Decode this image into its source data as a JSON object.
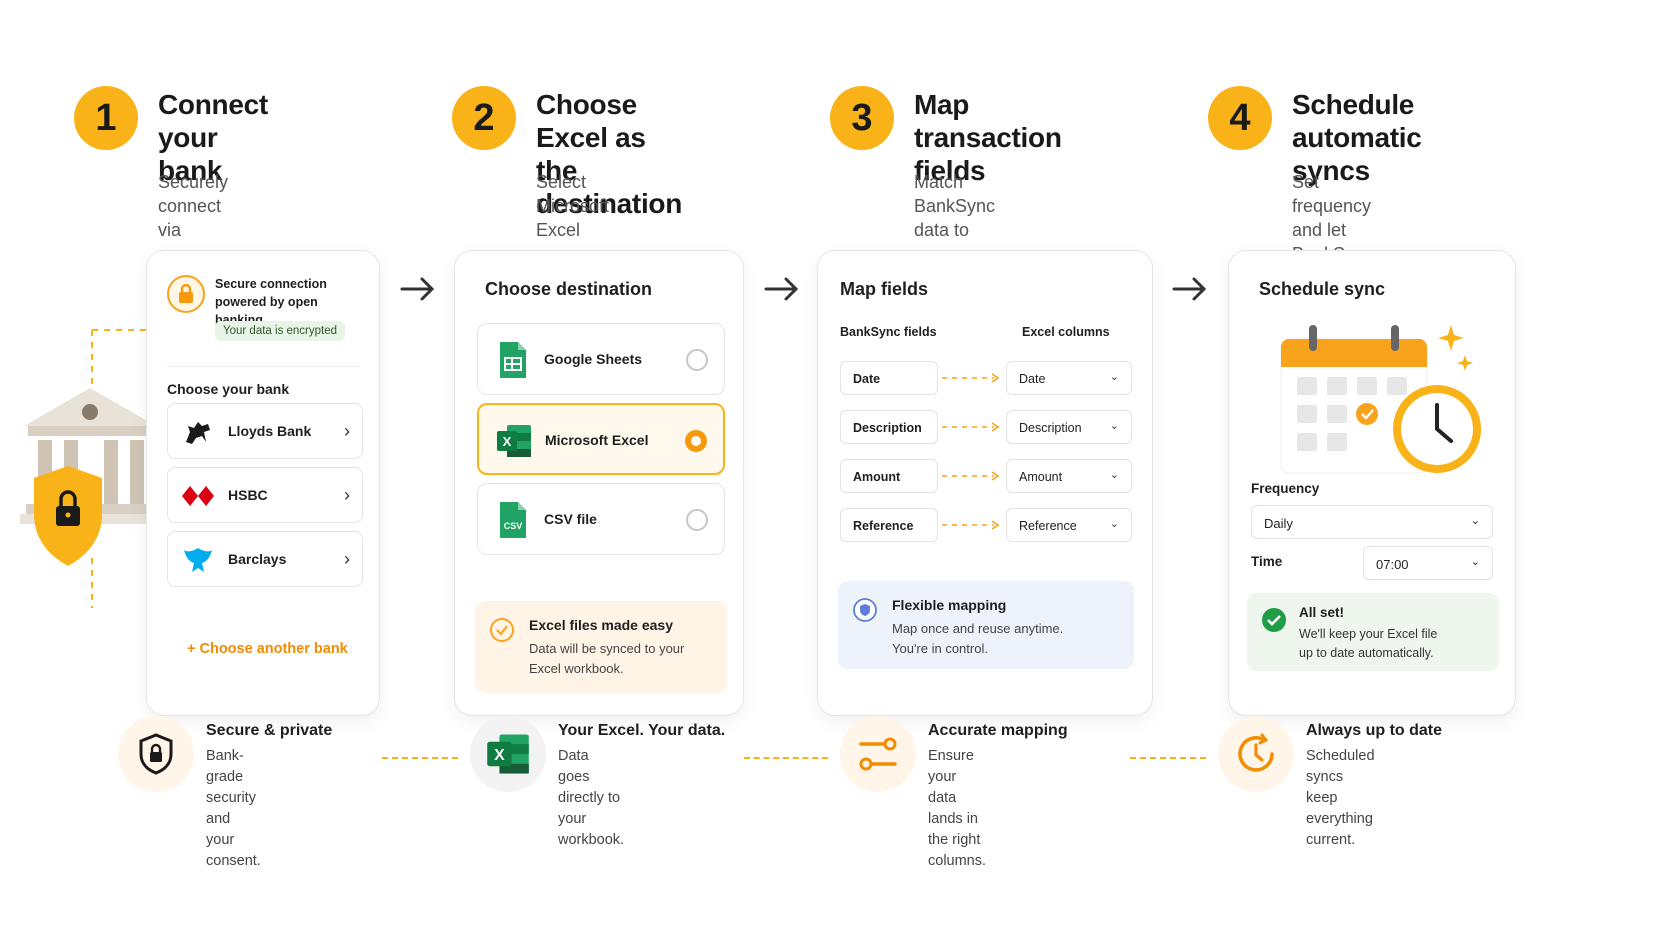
{
  "steps": [
    {
      "number": "1",
      "title": "Connect\nyour bank",
      "desc": "Securely connect via\nopen banking."
    },
    {
      "number": "2",
      "title": "Choose Excel as\nthe destination",
      "desc": "Select Microsoft Excel\nas your output."
    },
    {
      "number": "3",
      "title": "Map transaction\nfields",
      "desc": "Match BankSync data to\nyour Excel columns."
    },
    {
      "number": "4",
      "title": "Schedule automatic\nsyncs",
      "desc": "Set frequency and let\nBankSync do the rest."
    }
  ],
  "connect": {
    "secure_text": "Secure connection\npowered by open banking",
    "encrypted_badge": "Your data is encrypted",
    "choose_label": "Choose your bank",
    "banks": [
      {
        "name": "Lloyds Bank",
        "logo": "horse-icon"
      },
      {
        "name": "HSBC",
        "logo": "hsbc-hexagon-icon"
      },
      {
        "name": "Barclays",
        "logo": "eagle-icon"
      }
    ],
    "another_bank": "+   Choose another bank"
  },
  "destination": {
    "title": "Choose destination",
    "options": [
      {
        "name": "Google Sheets",
        "selected": false
      },
      {
        "name": "Microsoft Excel",
        "selected": true
      },
      {
        "name": "CSV file",
        "selected": false
      }
    ],
    "info_title": "Excel files made easy",
    "info_body": "Data will be synced to your\nExcel workbook."
  },
  "mapping": {
    "title": "Map fields",
    "col_source": "BankSync fields",
    "col_target": "Excel columns",
    "rows": [
      {
        "source": "Date",
        "target": "Date"
      },
      {
        "source": "Description",
        "target": "Description"
      },
      {
        "source": "Amount",
        "target": "Amount"
      },
      {
        "source": "Reference",
        "target": "Reference"
      }
    ],
    "info_title": "Flexible mapping",
    "info_body": "Map once and reuse anytime.\nYou're in control."
  },
  "schedule": {
    "title": "Schedule sync",
    "frequency_label": "Frequency",
    "frequency_value": "Daily",
    "time_label": "Time",
    "time_value": "07:00",
    "allset_title": "All set!",
    "allset_body": "We'll keep your Excel file\nup to date automatically."
  },
  "features": [
    {
      "title": "Secure & private",
      "body": "Bank-grade security and\nyour consent.",
      "icon": "shield-lock-icon"
    },
    {
      "title": "Your Excel. Your data.",
      "body": "Data goes directly to\nyour workbook.",
      "icon": "excel-icon"
    },
    {
      "title": "Accurate mapping",
      "body": "Ensure your data lands in\nthe right columns.",
      "icon": "mapping-icon"
    },
    {
      "title": "Always up to date",
      "body": "Scheduled syncs keep\neverything current.",
      "icon": "clock-refresh-icon"
    }
  ],
  "colors": {
    "accent": "#f9b218",
    "orange": "#f28c00",
    "excel_green": "#1d7044",
    "sheets_green": "#21a366"
  }
}
